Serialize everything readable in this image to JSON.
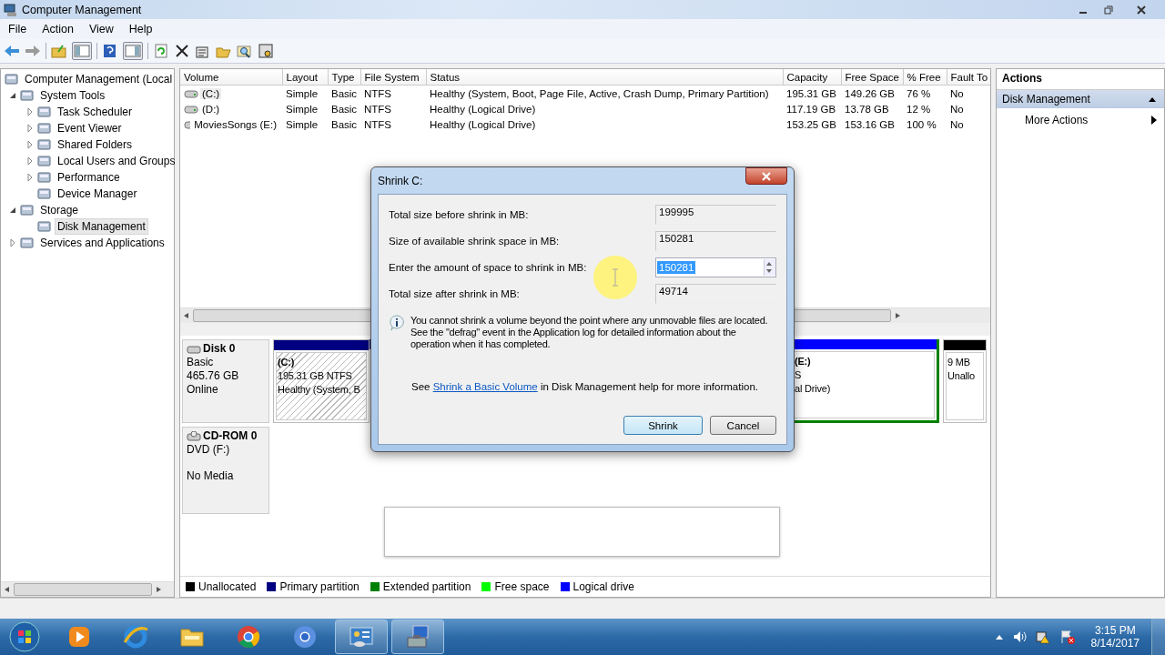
{
  "window": {
    "title": "Computer Management"
  },
  "menu": [
    "File",
    "Action",
    "View",
    "Help"
  ],
  "tree": [
    {
      "label": "Computer Management (Local",
      "selected": false,
      "children": [
        {
          "label": "System Tools",
          "expanded": true,
          "selected": false,
          "children": [
            {
              "label": "Task Scheduler",
              "expanded": false,
              "selected": false
            },
            {
              "label": "Event Viewer",
              "expanded": false,
              "selected": false
            },
            {
              "label": "Shared Folders",
              "expanded": false,
              "selected": false
            },
            {
              "label": "Local Users and Groups",
              "expanded": false,
              "selected": false
            },
            {
              "label": "Performance",
              "expanded": false,
              "selected": false
            },
            {
              "label": "Device Manager",
              "selected": false
            }
          ]
        },
        {
          "label": "Storage",
          "expanded": true,
          "selected": false,
          "children": [
            {
              "label": "Disk Management",
              "selected": true
            }
          ]
        },
        {
          "label": "Services and Applications",
          "expanded": false,
          "selected": false
        }
      ]
    }
  ],
  "table": {
    "columns": [
      "Volume",
      "Layout",
      "Type",
      "File System",
      "Status",
      "Capacity",
      "Free Space",
      "% Free",
      "Fault To"
    ],
    "rows": [
      {
        "selected": true,
        "cells": [
          "(C:)",
          "Simple",
          "Basic",
          "NTFS",
          "Healthy (System, Boot, Page File, Active, Crash Dump, Primary Partition)",
          "195.31 GB",
          "149.26 GB",
          "76 %",
          "No"
        ]
      },
      {
        "selected": false,
        "cells": [
          "(D:)",
          "Simple",
          "Basic",
          "NTFS",
          "Healthy (Logical Drive)",
          "117.19 GB",
          "13.78 GB",
          "12 %",
          "No"
        ]
      },
      {
        "selected": false,
        "cells": [
          "MoviesSongs (E:)",
          "Simple",
          "Basic",
          "NTFS",
          "Healthy (Logical Drive)",
          "153.25 GB",
          "153.16 GB",
          "100 %",
          "No"
        ]
      }
    ]
  },
  "disks": [
    {
      "kind": "disk",
      "name": "Disk 0",
      "lines": [
        "Basic",
        "465.76 GB",
        "Online"
      ],
      "partitions": [
        {
          "kind": "primary",
          "selected": true,
          "lines": [
            "(C:)",
            "195.31 GB NTFS",
            "Healthy (System, B"
          ]
        },
        {
          "kind": "logical",
          "selected": false,
          "lines": [
            "(E:)",
            "S",
            "al Drive)"
          ]
        },
        {
          "kind": "unallocated",
          "selected": false,
          "lines": [
            "9 MB",
            "Unallo"
          ]
        }
      ]
    },
    {
      "kind": "cdrom",
      "name": "CD-ROM 0",
      "lines": [
        "DVD (F:)"
      ],
      "note": "No Media"
    }
  ],
  "legend": [
    {
      "label": "Unallocated",
      "color": "#000000"
    },
    {
      "label": "Primary partition",
      "color": "#000080"
    },
    {
      "label": "Extended partition",
      "color": "#008000"
    },
    {
      "label": "Free space",
      "color": "#00ff00"
    },
    {
      "label": "Logical drive",
      "color": "#0000ff"
    }
  ],
  "actions": {
    "title": "Actions",
    "sections": [
      {
        "label": "Disk Management",
        "expanded": true,
        "items": [
          "More Actions"
        ]
      }
    ]
  },
  "dialog": {
    "title": "Shrink C:",
    "fields": [
      {
        "kind": "readonly",
        "label": "Total size before shrink in MB:",
        "value": "199995",
        "selected": false
      },
      {
        "kind": "readonly",
        "label": "Size of available shrink space in MB:",
        "value": "150281",
        "selected": false
      },
      {
        "kind": "spin",
        "label": "Enter the amount of space to shrink in MB:",
        "value": "150281",
        "selected": true
      },
      {
        "kind": "readonly",
        "label": "Total size after shrink in MB:",
        "value": "49714",
        "selected": false
      }
    ],
    "info": "You cannot shrink a volume beyond the point where any unmovable files are located. See the \"defrag\" event in the Application log for detailed information about the operation when it has completed.",
    "help": {
      "before": "See",
      "link": "Shrink a Basic Volume",
      "after": "in Disk Management help for more information."
    },
    "buttons": [
      {
        "label": "Shrink",
        "default": true
      },
      {
        "label": "Cancel",
        "default": false
      }
    ]
  },
  "taskbar": {
    "items": [
      {
        "running": false
      },
      {
        "running": false
      },
      {
        "running": false
      },
      {
        "running": false
      },
      {
        "running": false
      },
      {
        "running": true
      },
      {
        "running": true
      }
    ],
    "time": "3:15 PM",
    "date": "8/14/2017"
  }
}
